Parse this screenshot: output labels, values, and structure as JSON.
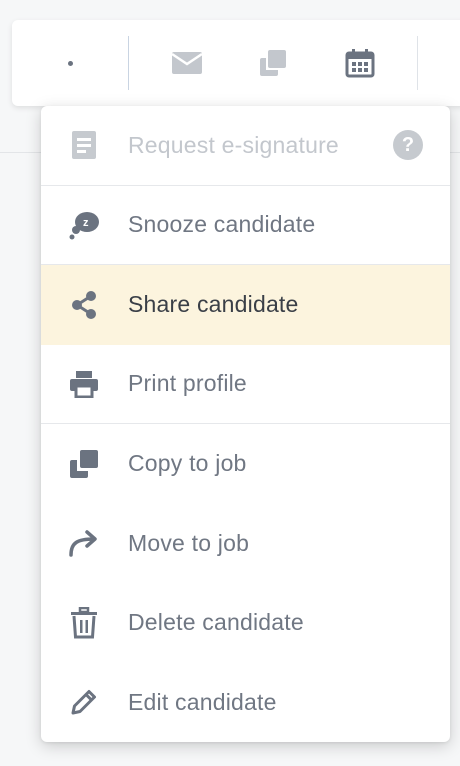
{
  "toolbar": {
    "buttons": [
      {
        "name": "more-options",
        "icon": "more-dots-icon"
      },
      {
        "name": "email",
        "icon": "envelope-icon"
      },
      {
        "name": "copy",
        "icon": "copy-icon"
      },
      {
        "name": "schedule",
        "icon": "calendar-icon"
      }
    ],
    "colors": {
      "icon": "#6b7380",
      "icon_muted": "#c3c7cd",
      "separator": "#c9d4e2"
    }
  },
  "menu": {
    "items": [
      {
        "label": "Request e-signature",
        "icon": "document-icon",
        "disabled": true,
        "help": "?"
      },
      {
        "label": "Snooze candidate",
        "icon": "snooze-icon"
      },
      {
        "label": "Share candidate",
        "icon": "share-icon",
        "highlighted": true
      },
      {
        "label": "Print profile",
        "icon": "printer-icon"
      },
      {
        "label": "Copy to job",
        "icon": "copy-icon"
      },
      {
        "label": "Move to job",
        "icon": "forward-arrow-icon"
      },
      {
        "label": "Delete candidate",
        "icon": "trash-icon"
      },
      {
        "label": "Edit candidate",
        "icon": "pencil-icon"
      }
    ],
    "colors": {
      "highlight_bg": "#fcf4de",
      "text": "#707783",
      "text_disabled": "#c3c7cd",
      "icon": "#6b7380"
    }
  }
}
